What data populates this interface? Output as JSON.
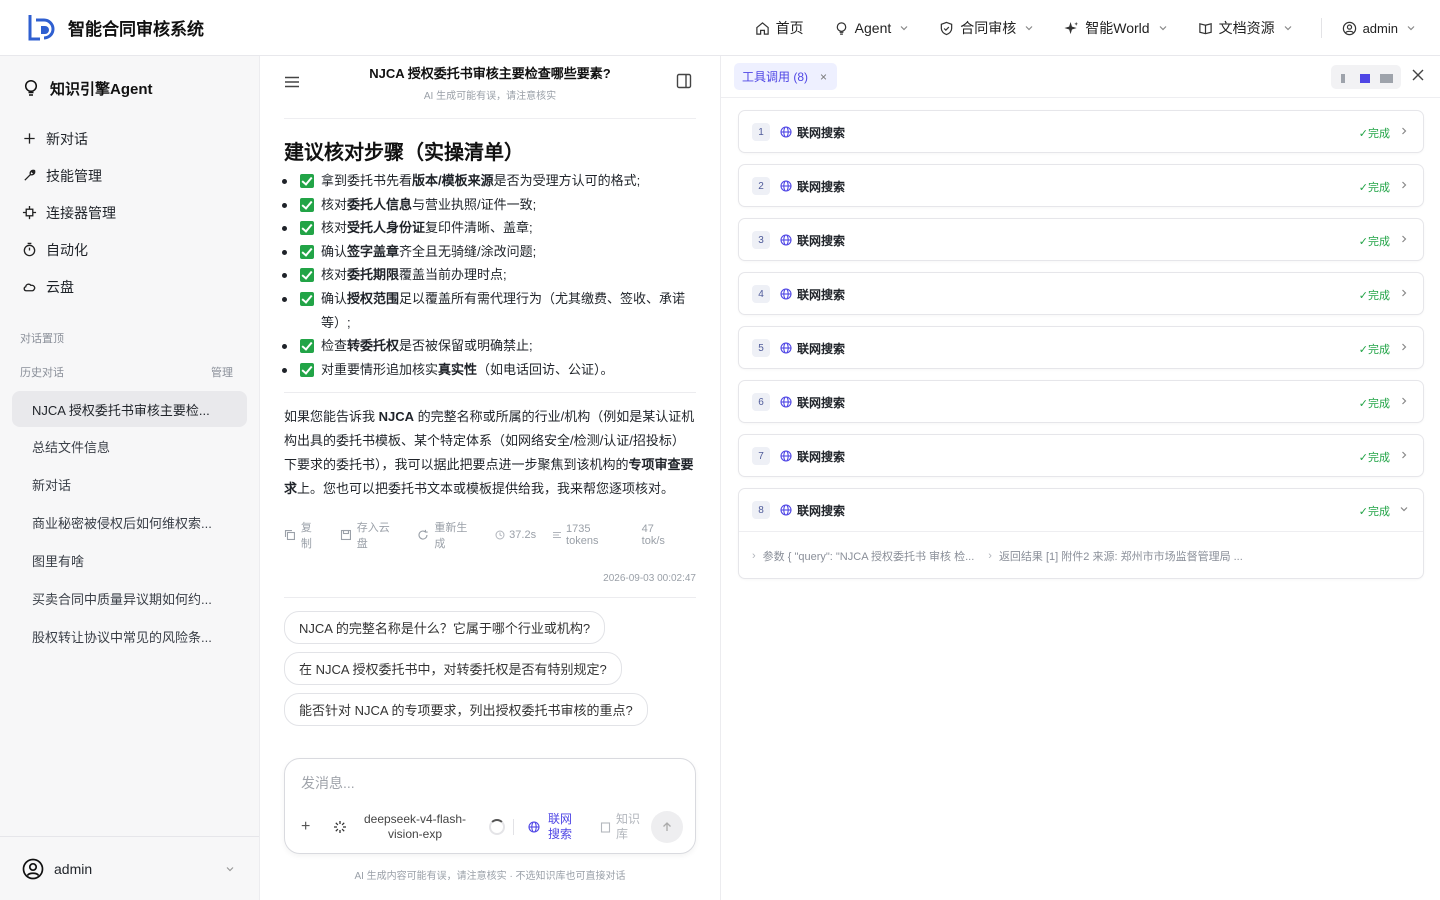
{
  "app": {
    "title": "智能合同审核系统",
    "nav": [
      {
        "label": "首页",
        "icon": "home-icon"
      },
      {
        "label": "Agent",
        "icon": "bulb-icon"
      },
      {
        "label": "合同审核",
        "icon": "shield-icon"
      },
      {
        "label": "智能World",
        "icon": "sparkle-icon"
      },
      {
        "label": "文档资源",
        "icon": "book-icon"
      }
    ],
    "user": "admin"
  },
  "sidebar": {
    "title": "知识引擎Agent",
    "menu": [
      {
        "label": "新对话",
        "icon": "plus-icon"
      },
      {
        "label": "技能管理",
        "icon": "wrench-icon"
      },
      {
        "label": "连接器管理",
        "icon": "connector-icon"
      },
      {
        "label": "自动化",
        "icon": "timer-icon"
      },
      {
        "label": "云盘",
        "icon": "cloud-icon"
      }
    ],
    "pinned_label": "对话置顶",
    "history_label": "历史对话",
    "manage_label": "管理",
    "history": [
      "NJCA 授权委托书审核主要检...",
      "总结文件信息",
      "新对话",
      "商业秘密被侵权后如何维权索...",
      "图里有啥",
      "买卖合同中质量异议期如何约...",
      "股权转让协议中常见的风险条..."
    ],
    "footer_user": "admin"
  },
  "chat": {
    "title": "NJCA 授权委托书审核主要检查哪些要素?",
    "subtitle": "AI 生成可能有误，请注意核实",
    "heading": "建议核对步骤（实操清单）",
    "checklist": [
      {
        "pre": "拿到委托书先看",
        "bold": "版本/模板来源",
        "post": "是否为受理方认可的格式;"
      },
      {
        "pre": "核对",
        "bold": "委托人信息",
        "post": "与营业执照/证件一致;"
      },
      {
        "pre": "核对",
        "bold": "受托人身份证",
        "post": "复印件清晰、盖章;"
      },
      {
        "pre": "确认",
        "bold": "签字盖章",
        "post": "齐全且无骑缝/涂改问题;"
      },
      {
        "pre": "核对",
        "bold": "委托期限",
        "post": "覆盖当前办理时点;"
      },
      {
        "pre": "确认",
        "bold": "授权范围",
        "post": "足以覆盖所有需代理行为（尤其缴费、签收、承诺等）;"
      },
      {
        "pre": "检查",
        "bold": "转委托权",
        "post": "是否被保留或明确禁止;"
      },
      {
        "pre": "对重要情形追加核实",
        "bold": "真实性",
        "post": "（如电话回访、公证）。"
      }
    ],
    "para": {
      "p1": "如果您能告诉我 ",
      "b1": "NJCA",
      "p2": " 的完整名称或所属的行业/机构（例如是某认证机构出具的委托书模板、某个特定体系（如网络安全/检测/认证/招投标）下要求的委托书），我可以据此把要点进一步聚焦到该机构的",
      "b2": "专项审查要求",
      "p3": "上。您也可以把委托书文本或模板提供给我，我来帮您逐项核对。"
    },
    "actions": {
      "copy": "复制",
      "save": "存入云盘",
      "regen": "重新生成"
    },
    "stats": {
      "time": "37.2s",
      "tokens": "1735 tokens",
      "speed": "47 tok/s"
    },
    "timestamp": "2026-09-03 00:02:47",
    "suggestions": [
      "NJCA 的完整名称是什么？它属于哪个行业或机构?",
      "在 NJCA 授权委托书中，对转委托权是否有特别规定?",
      "能否针对 NJCA 的专项要求，列出授权委托书审核的重点?"
    ],
    "composer": {
      "placeholder": "发消息...",
      "model": "deepseek-v4-flash-vision-exp",
      "web_search": "联网搜索",
      "kb": "知识库"
    },
    "disclaimer": "AI 生成内容可能有误，请注意核实 · 不选知识库也可直接对话"
  },
  "tools_panel": {
    "tab_label": "工具调用 (8)",
    "status_label": "✓完成",
    "items": [
      {
        "num": "1",
        "name": "联网搜索"
      },
      {
        "num": "2",
        "name": "联网搜索"
      },
      {
        "num": "3",
        "name": "联网搜索"
      },
      {
        "num": "4",
        "name": "联网搜索"
      },
      {
        "num": "5",
        "name": "联网搜索"
      },
      {
        "num": "6",
        "name": "联网搜索"
      },
      {
        "num": "7",
        "name": "联网搜索"
      },
      {
        "num": "8",
        "name": "联网搜索"
      }
    ],
    "expanded_params": "参数 { \"query\": \"NJCA 授权委托书 审核 检...",
    "expanded_result": "返回结果 [1] 附件2 来源: 郑州市市场监督管理局 ..."
  },
  "colors": {
    "accent": "#4f46e5",
    "success": "#22a447"
  }
}
